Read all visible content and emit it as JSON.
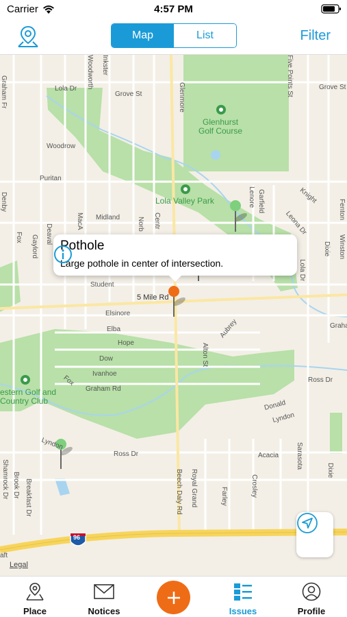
{
  "status_bar": {
    "carrier": "Carrier",
    "time": "4:57 PM"
  },
  "nav": {
    "segments": [
      "Map",
      "List"
    ],
    "selected_segment": "Map",
    "filter_label": "Filter"
  },
  "map": {
    "streets": {
      "lola_dr": "Lola Dr",
      "grove_st": "Grove St",
      "grove_st_2": "Grove St",
      "woodrow": "Woodrow",
      "puritan": "Puritan",
      "midland": "Midland",
      "student": "Student",
      "five_mile": "5 Mile Rd",
      "elsinore": "Elsinore",
      "elba": "Elba",
      "hope": "Hope",
      "dow": "Dow",
      "ivanhoe": "Ivanhoe",
      "graham_rd": "Graham Rd",
      "fox": "Fox",
      "ross_dr": "Ross Dr",
      "ross_dr_2": "Ross Dr",
      "acacia": "Acacia",
      "donald": "Donald",
      "lyndon": "Lyndon",
      "lyndon_2": "Lyndon",
      "aubrey": "Aubrey",
      "alton_st": "Alton St",
      "beech_daly": "Beech Daly Rd",
      "royal_grand": "Royal Grand",
      "farley": "Farley",
      "crosley": "Crosley",
      "sarasota": "Sarasota",
      "dixie": "Dixie",
      "dixie_2": "Dixie",
      "glenmore": "Glenmore",
      "inkster": "Inkster",
      "woodworth": "Woodworth",
      "winston": "Winston",
      "fenton": "Fenton",
      "knight": "Knight",
      "garfield": "Garfield",
      "lenore": "Lenore",
      "leona_dr": "Leona Dr",
      "graham_fr": "Graham Fr",
      "denby": "Denby",
      "gaylord": "Gaylord",
      "macarthur": "MacA",
      "norb": "Norb",
      "centr": "Centr",
      "deavel": "Deaval",
      "breakfast_dr": "Breakfast Dr",
      "brook_dr": "Brook Dr",
      "shamrock_dr": "Shamrock Dr",
      "five_points": "Five Points St",
      "lola_dr_2": "Lola Dr",
      "grahm": "Graha",
      "fox_2": "Fox",
      "aft": "aft"
    },
    "parks": {
      "glenhurst": "Glenhurst\nGolf Course",
      "lola_valley": "Lola Valley Park",
      "western_golf": "estern Golf and\nCountry Club"
    },
    "highway_shield": "96",
    "legal": "Legal"
  },
  "callout": {
    "title": "Pothole",
    "description": "Large pothole in center of intersection."
  },
  "tabs": [
    {
      "label": "Place",
      "icon": "place-icon",
      "active": false
    },
    {
      "label": "Notices",
      "icon": "envelope-icon",
      "active": false
    },
    {
      "label": "Issues",
      "icon": "list-icon",
      "active": true
    },
    {
      "label": "Profile",
      "icon": "profile-icon",
      "active": false
    }
  ],
  "colors": {
    "accent": "#1a9bd7",
    "add_button": "#ef6c17",
    "park": "#b8e0a8",
    "map_bg": "#f3efe6",
    "highway": "#f7d55c",
    "pin_green": "#7ecf7e",
    "pin_orange": "#ef6c17"
  }
}
